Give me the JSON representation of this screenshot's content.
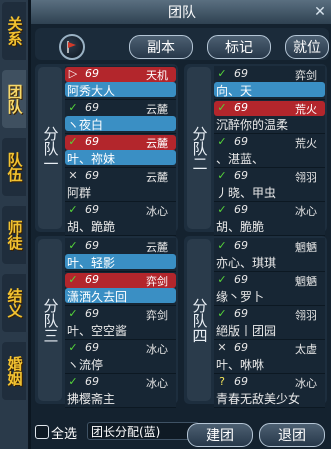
{
  "side_tabs": [
    {
      "label": "关系"
    },
    {
      "label": "团队"
    },
    {
      "label": "队伍"
    },
    {
      "label": "师徒"
    },
    {
      "label": "结义"
    },
    {
      "label": "婚姻"
    }
  ],
  "title": "团队",
  "toolbar": {
    "dungeon_label": "副本",
    "mark_label": "标记",
    "ready_label": "就位"
  },
  "squads": [
    {
      "label": "分队一",
      "members": [
        {
          "level": "69",
          "class": "天机",
          "name": "阿秀大人",
          "status": "leader"
        },
        {
          "level": "69",
          "class": "云麓",
          "name": "ヽ夜白",
          "status": "check"
        },
        {
          "level": "69",
          "class": "云麓",
          "name": "叶、祢妹",
          "status": "check"
        },
        {
          "level": "69",
          "class": "云麓",
          "name": "阿群",
          "status": "cross"
        },
        {
          "level": "69",
          "class": "冰心",
          "name": "胡、跪跪",
          "status": "check"
        }
      ]
    },
    {
      "label": "分队二",
      "members": [
        {
          "level": "69",
          "class": "弈剑",
          "name": "向、天",
          "status": "check"
        },
        {
          "level": "69",
          "class": "荒火",
          "name": "沉醉你的温柔",
          "status": "check"
        },
        {
          "level": "69",
          "class": "荒火",
          "name": "、湛蓝、",
          "status": "check"
        },
        {
          "level": "69",
          "class": "翎羽",
          "name": "丿晓、甲虫",
          "status": "check"
        },
        {
          "level": "69",
          "class": "冰心",
          "name": "胡、脆脆",
          "status": "check"
        }
      ]
    },
    {
      "label": "分队三",
      "members": [
        {
          "level": "69",
          "class": "云麓",
          "name": "叶、轻影",
          "status": "check"
        },
        {
          "level": "69",
          "class": "弈剑",
          "name": "潇洒久去回",
          "status": "check"
        },
        {
          "level": "69",
          "class": "弈剑",
          "name": "叶、空空酱",
          "status": "check"
        },
        {
          "level": "69",
          "class": "冰心",
          "name": "ヽ流停",
          "status": "check"
        },
        {
          "level": "69",
          "class": "冰心",
          "name": "拂樱斋主",
          "status": "check"
        }
      ]
    },
    {
      "label": "分队四",
      "members": [
        {
          "level": "69",
          "class": "魍魉",
          "name": "亦心、琪琪",
          "status": "check"
        },
        {
          "level": "69",
          "class": "魍魉",
          "name": "缘丶罗卜",
          "status": "check"
        },
        {
          "level": "69",
          "class": "翎羽",
          "name": "絕版丨团园",
          "status": "check"
        },
        {
          "level": "69",
          "class": "太虚",
          "name": "叶、咻咻",
          "status": "cross"
        },
        {
          "level": "69",
          "class": "冰心",
          "name": "青春无敌美少女",
          "status": "question"
        }
      ]
    }
  ],
  "footer": {
    "select_all_label": "全选",
    "assign_mode": "团长分配(蓝)",
    "create_label": "建团",
    "leave_label": "退团"
  },
  "colors": {
    "accent_gold": "#f2c230",
    "leader_red": "#b3262c",
    "highlight_blue": "#3a8fc4",
    "check_green": "#56d63a"
  }
}
